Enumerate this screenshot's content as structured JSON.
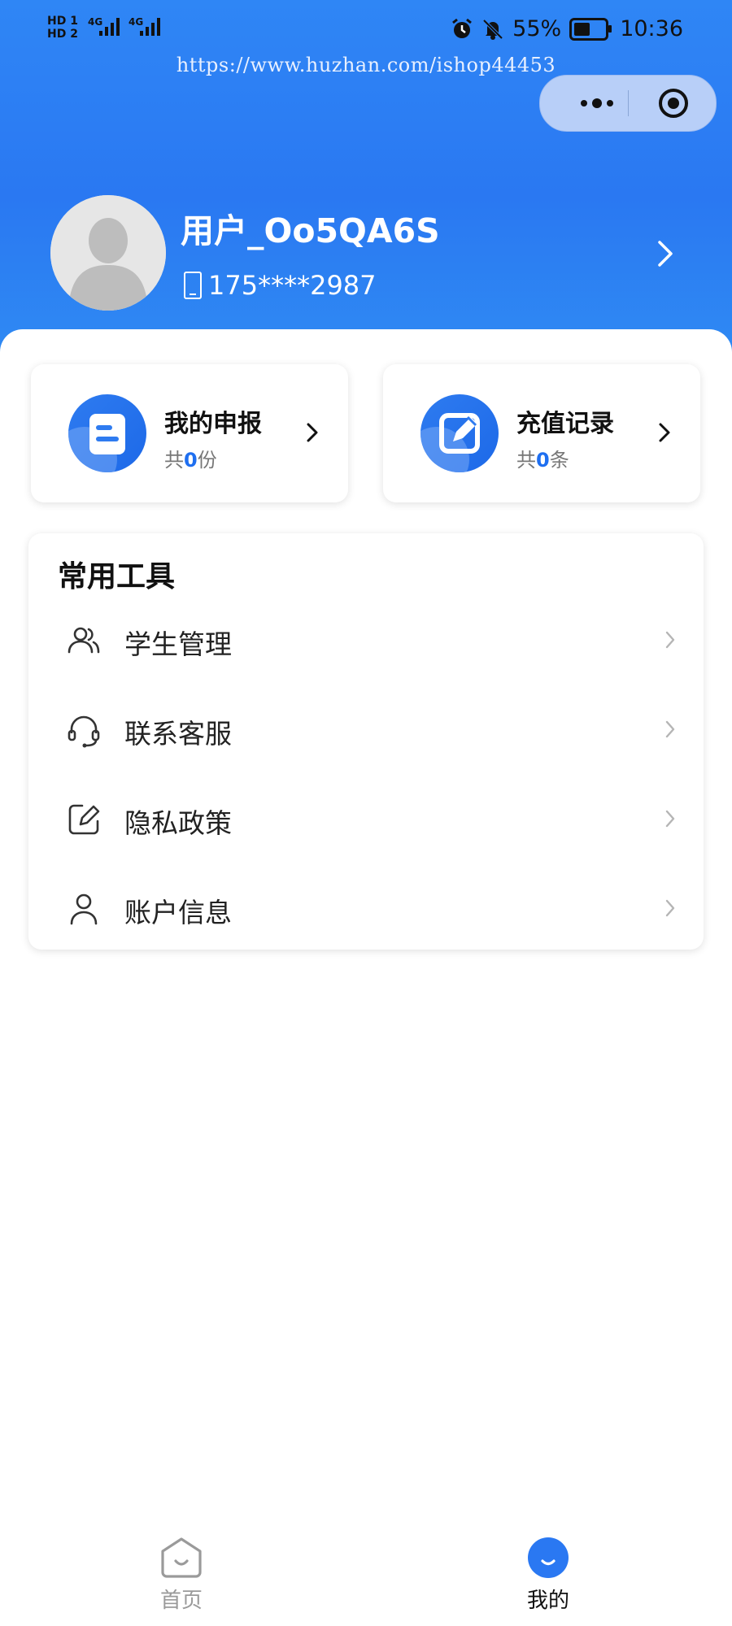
{
  "status_bar": {
    "hd1": "HD 1",
    "hd2": "HD 2",
    "net1": "4G",
    "net2": "4G",
    "battery_percent": "55%",
    "battery_level": 0.55,
    "time": "10:36"
  },
  "watermark_url": "https://www.huzhan.com/ishop44453",
  "profile": {
    "username": "用户_Oo5QA6S",
    "phone": "175****2987"
  },
  "cards": [
    {
      "title": "我的申报",
      "prefix": "共",
      "count": "0",
      "suffix": "份"
    },
    {
      "title": "充值记录",
      "prefix": "共",
      "count": "0",
      "suffix": "条"
    }
  ],
  "tools": {
    "title": "常用工具",
    "items": [
      {
        "label": "学生管理",
        "icon": "users-icon"
      },
      {
        "label": "联系客服",
        "icon": "headset-icon"
      },
      {
        "label": "隐私政策",
        "icon": "edit-note-icon"
      },
      {
        "label": "账户信息",
        "icon": "user-icon"
      }
    ]
  },
  "tabbar": {
    "items": [
      {
        "label": "首页",
        "active": false
      },
      {
        "label": "我的",
        "active": true
      }
    ]
  },
  "colors": {
    "primary": "#2a78f2",
    "accent_blue": "#1f6ff0",
    "inactive_gray": "#9a9a9a"
  }
}
